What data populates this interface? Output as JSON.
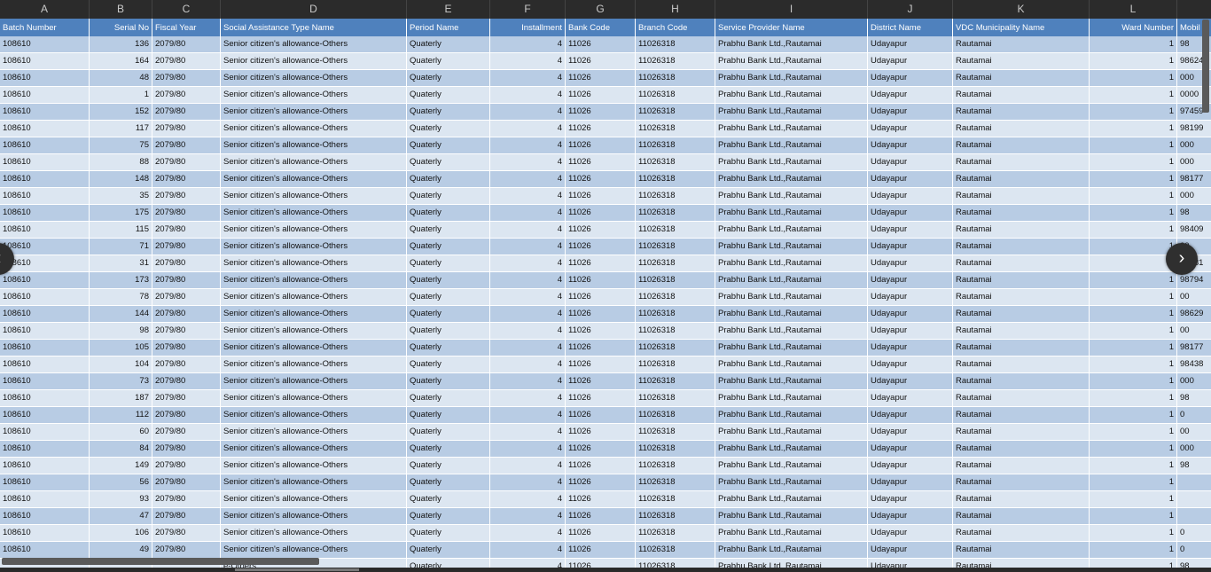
{
  "columns": [
    "A",
    "B",
    "C",
    "D",
    "E",
    "F",
    "G",
    "H",
    "I",
    "J",
    "K",
    "L",
    ""
  ],
  "headers": [
    "Batch Number",
    "Serial No",
    "Fiscal Year",
    "Social Assistance Type Name",
    "Period Name",
    "Installment",
    "Bank Code",
    "Branch Code",
    "Service Provider Name",
    "District Name",
    "VDC Municipality Name",
    "Ward Number",
    "Mobil"
  ],
  "common": {
    "batch": "108610",
    "fiscal_year": "2079/80",
    "assistance_type": "Senior citizen's allowance-Others",
    "assistance_type_partial": "e-Others",
    "period": "Quaterly",
    "installment": "4",
    "bank_code": "11026",
    "branch_code": "11026318",
    "provider": "Prabhu Bank Ltd.,Rautamai",
    "district": "Udayapur",
    "municipality": "Rautamai",
    "ward": "1"
  },
  "serials": [
    "136",
    "164",
    "48",
    "1",
    "152",
    "117",
    "75",
    "88",
    "148",
    "35",
    "175",
    "115",
    "71",
    "31",
    "173",
    "78",
    "144",
    "98",
    "105",
    "104",
    "73",
    "187",
    "112",
    "60",
    "84",
    "149",
    "56",
    "93",
    "47",
    "106",
    "49",
    ""
  ],
  "mobiles": [
    "98",
    "98624",
    "000",
    "0000",
    "97459",
    "98199",
    "000",
    "000",
    "98177",
    "000",
    "98",
    "98409",
    "00",
    "98481",
    "98794",
    "00",
    "98629",
    "00",
    "98177",
    "98438",
    "000",
    "98",
    "0",
    "00",
    "000",
    "98",
    "",
    "",
    "",
    "0",
    "0",
    "98"
  ],
  "ui": {
    "prev_arrow": "‹",
    "next_arrow": "›"
  }
}
